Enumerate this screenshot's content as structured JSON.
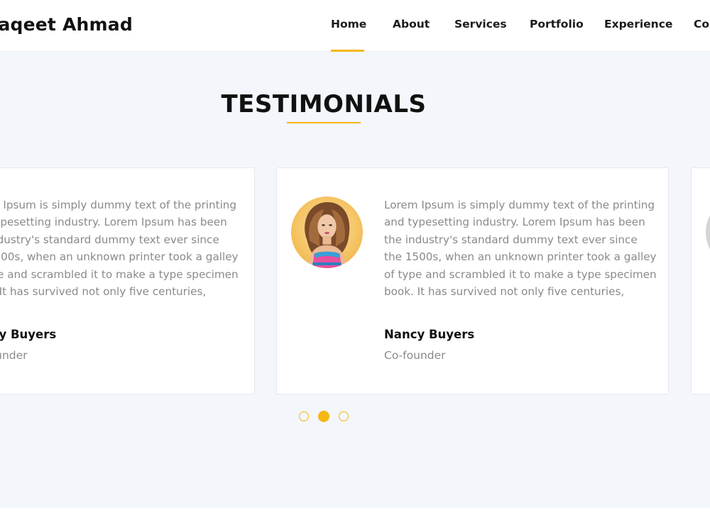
{
  "header": {
    "brand": "Raqeet Ahmad",
    "nav": [
      {
        "label": "Home",
        "active": true
      },
      {
        "label": "About",
        "active": false
      },
      {
        "label": "Services",
        "active": false
      },
      {
        "label": "Portfolio",
        "active": false
      },
      {
        "label": "Experience",
        "active": false
      },
      {
        "label": "Contact",
        "active": false
      }
    ]
  },
  "testimonials": {
    "title": "TESTIMONIALS",
    "cards": [
      {
        "quote": "Lorem Ipsum is simply dummy text of the printing and typesetting industry. Lorem Ipsum has been the industry's standard dummy text ever since the 1500s, when an unknown printer took a galley of type and scrambled it to make a type specimen book. It has survived not only five centuries,",
        "name": "Nancy Buyers",
        "role": "Co-founder"
      },
      {
        "quote": "Lorem Ipsum is simply dummy text of the printing and typesetting industry. Lorem Ipsum has been the industry's standard dummy text ever since the 1500s, when an unknown printer took a galley of type and scrambled it to make a type specimen book. It has survived not only five centuries,",
        "name": "Nancy Buyers",
        "role": "Co-founder"
      }
    ],
    "active_slide": 2,
    "slide_count": 3
  },
  "colors": {
    "accent": "#f5b714",
    "section_bg": "#f3f6fb",
    "text_muted": "#8a8a8a"
  }
}
